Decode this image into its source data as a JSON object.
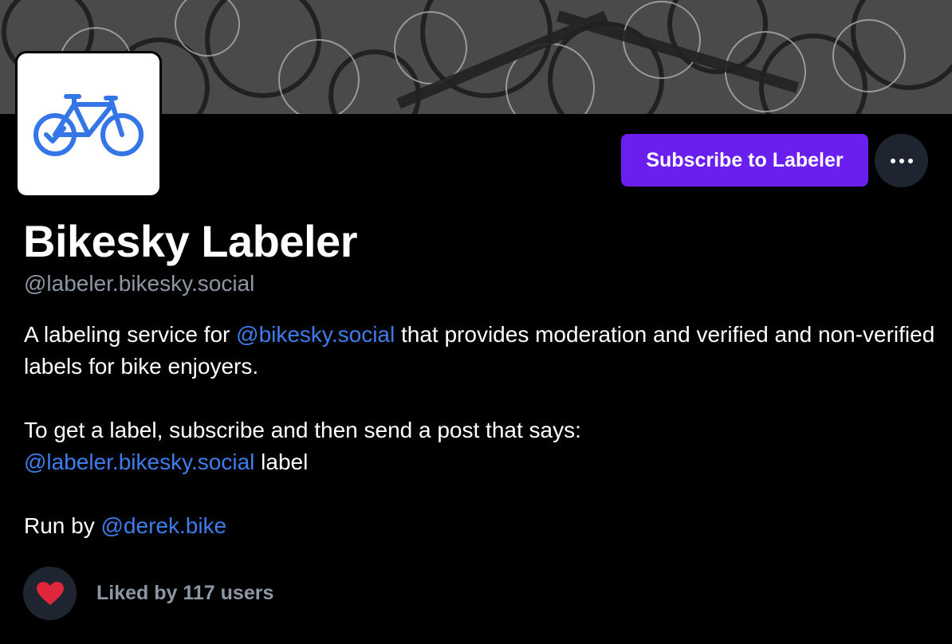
{
  "profile": {
    "display_name": "Bikesky Labeler",
    "handle": "@labeler.bikesky.social",
    "avatar_icon": "bicycle-check-icon",
    "banner_image": "bicycles-photo-grayscale"
  },
  "actions": {
    "subscribe_label": "Subscribe to Labeler",
    "more_icon": "ellipsis-icon"
  },
  "bio": {
    "line1_prefix": "A labeling service for ",
    "line1_mention": "@bikesky.social",
    "line1_suffix": " that provides moderation and verified and non-verified labels for bike enjoyers.",
    "line2": "To get a label, subscribe and then send a post that says:",
    "line3_mention": "@labeler.bikesky.social",
    "line3_suffix": " label",
    "line4_prefix": "Run by ",
    "line4_mention": "@derek.bike"
  },
  "likes": {
    "text": "Liked by 117 users",
    "icon": "heart-icon"
  },
  "colors": {
    "accent": "#6a1ef0",
    "link": "#3e7dee",
    "heart": "#e0263a",
    "secondary_text": "#8d96a3"
  }
}
